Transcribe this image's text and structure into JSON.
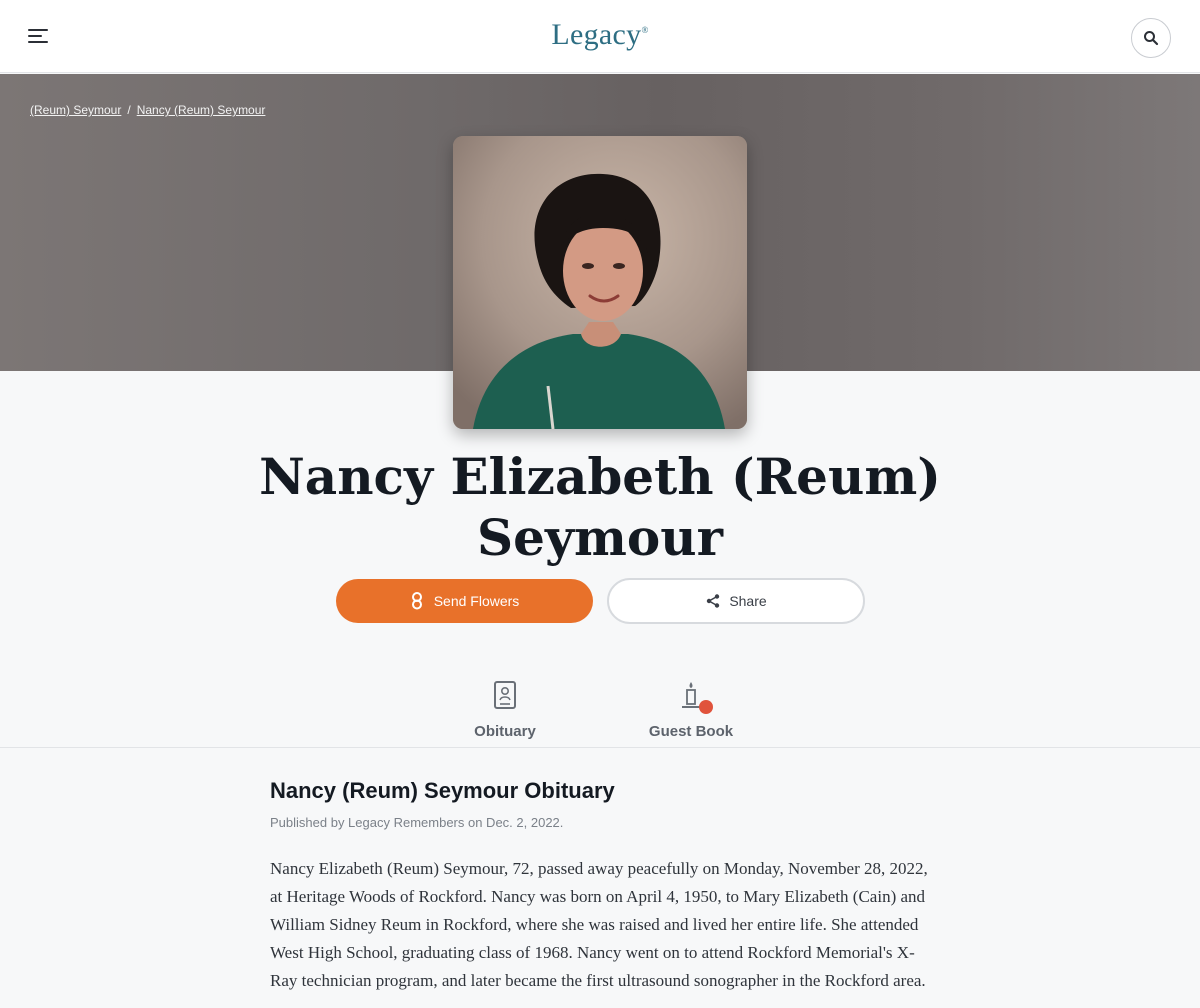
{
  "header": {
    "logo_text": "Legacy",
    "logo_mark": "®",
    "menu_icon": "hamburger-icon",
    "search_icon": "search-icon"
  },
  "breadcrumb": {
    "items": [
      "(Reum) Seymour",
      "Nancy (Reum) Seymour"
    ],
    "separator": "/"
  },
  "person": {
    "full_name": "Nancy Elizabeth (Reum) Seymour"
  },
  "actions": {
    "send_flowers_label": "Send Flowers",
    "share_label": "Share"
  },
  "tabs": [
    {
      "label": "Obituary",
      "icon": "obituary-icon"
    },
    {
      "label": "Guest Book",
      "icon": "guest-book-icon"
    }
  ],
  "obituary": {
    "title": "Nancy (Reum) Seymour Obituary",
    "published": "Published by Legacy Remembers on Dec. 2, 2022.",
    "body": "Nancy Elizabeth (Reum) Seymour, 72, passed away peacefully on Monday, November 28, 2022, at Heritage Woods of Rockford. Nancy was born on April 4, 1950, to Mary Elizabeth (Cain) and William Sidney Reum in Rockford, where she was raised and lived her entire life. She attended West High School, graduating class of 1968. Nancy went on to attend Rockford Memorial's X-Ray technician program, and later became the first ultrasound sonographer in the Rockford area."
  },
  "colors": {
    "accent_orange": "#e8712a",
    "logo_teal": "#2e6e83",
    "badge_red": "#e0533c"
  }
}
